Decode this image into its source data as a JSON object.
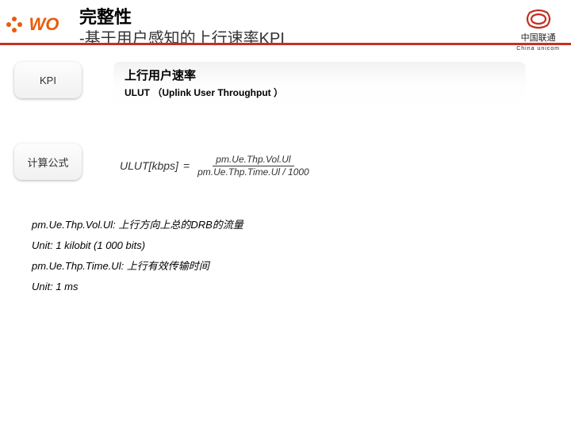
{
  "header": {
    "title_main": "完整性",
    "title_sub": "-基于用户感知的上行速率KPI",
    "wo_text": "WO",
    "unicom_bilingual": "中国联通",
    "unicom_en": "China unicom"
  },
  "row_kpi": {
    "label": "KPI",
    "line1": "上行用户速率",
    "line2": "ULUT （Uplink User Throughput ）"
  },
  "row_formula": {
    "label": "计算公式",
    "lhs": "ULUT[kbps]",
    "numerator": "pm.Ue.Thp.Vol.Ul",
    "denominator": "pm.Ue.Thp.Time.Ul / 1000"
  },
  "defs": {
    "d1": "pm.Ue.Thp.Vol.Ul: 上行方向上总的DRB的流量",
    "d2": "Unit: 1 kilobit (1 000 bits)",
    "d3": "pm.Ue.Thp.Time.Ul: 上行有效传输时间",
    "d4": "Unit: 1 ms"
  }
}
